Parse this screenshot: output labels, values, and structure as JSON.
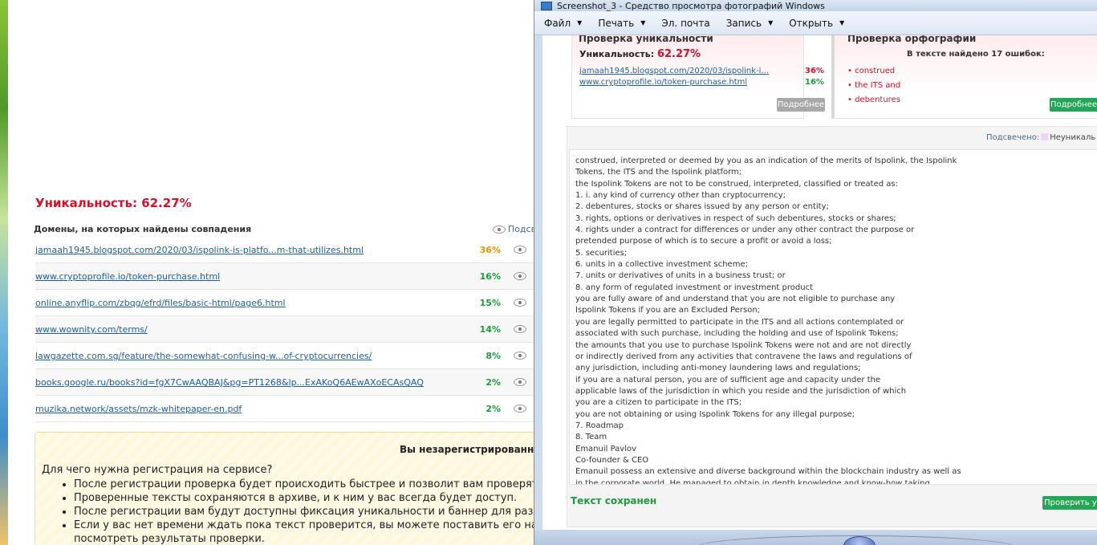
{
  "left_page": {
    "uniqueness_label": "Уникальность: ",
    "uniqueness_value": "62.27%",
    "domains_header": "Домены, на которых найдены совпадения",
    "highlight_link": "Подсв",
    "domains": [
      {
        "url": "jamaah1945.blogspot.com/2020/03/ispolink-is-platfo...m-that-utilizes.html",
        "percent": "36%",
        "color": "orange"
      },
      {
        "url": "www.cryptoprofile.io/token-purchase.html",
        "percent": "16%",
        "color": "green"
      },
      {
        "url": "online.anyflip.com/zbqg/efrd/files/basic-html/page6.html",
        "percent": "15%",
        "color": "green"
      },
      {
        "url": "www.wownity.com/terms/",
        "percent": "14%",
        "color": "green"
      },
      {
        "url": "lawgazette.com.sg/feature/the-somewhat-confusing-w...of-cryptocurrencies/",
        "percent": "8%",
        "color": "green"
      },
      {
        "url": "books.google.ru/books?id=fgX7CwAAQBAJ&pg=PT1268&lp...ExAKoQ6AEwAXoECAsQAQ",
        "percent": "2%",
        "color": "green"
      },
      {
        "url": "muzika.network/assets/mzk-whitepaper-en.pdf",
        "percent": "2%",
        "color": "green"
      }
    ],
    "notice": {
      "title": "Вы незарегистрированн",
      "question": "Для чего нужна регистрация на сервисе?",
      "items": [
        "После регистрации проверка будет происходить быстрее и позволит вам проверять больше те",
        "Проверенные тексты сохраняются в архиве, и к ним у вас всегда будет доступ.",
        "После регистрации вам будут доступны фиксация уникальности и баннер для размещения на с",
        "Если у вас нет времени ждать пока текст проверится, вы можете поставить его на проверку и",
        "посмотреть результаты проверки."
      ]
    }
  },
  "window": {
    "title": "Screenshot_3 - Средство просмотра фотографий Windows",
    "menu": [
      {
        "label": "Файл",
        "dropdown": true
      },
      {
        "label": "Печать",
        "dropdown": true
      },
      {
        "label": "Эл. почта",
        "dropdown": false
      },
      {
        "label": "Запись",
        "dropdown": true
      },
      {
        "label": "Открыть",
        "dropdown": true
      }
    ]
  },
  "viewer": {
    "uniq_card": {
      "title": "Проверка уникальности",
      "label": "Уникальность: ",
      "value": "62.27%",
      "links": [
        {
          "url": "jamaah1945.blogspot.com/2020/03/ispolink-i...",
          "percent": "36%",
          "color": "red"
        },
        {
          "url": "www.cryptoprofile.io/token-purchase.html",
          "percent": "16%",
          "color": "green"
        }
      ],
      "button": "Подробнее"
    },
    "orth_card": {
      "title": "Проверка орфографии",
      "subtitle": "В тексте найдено 17 ошибок:",
      "errors": [
        "• construed",
        "• the ITS and",
        "• debentures"
      ],
      "button": "Подробнее"
    },
    "highlight_label": "Подсвечено:",
    "highlight_rest": "Неуникаль",
    "text_lines": [
      "construed, interpreted or deemed by you as an indication of the merits of Ispolink, the Ispolink",
      "Tokens, the ITS and the Ispolink platform;",
      "the Ispolink Tokens are not to be construed, interpreted, classified or treated as:",
      "1. i. any kind of currency other than cryptocurrency;",
      "2. debentures, stocks or shares issued by any person or entity;",
      "3. rights, options or derivatives in respect of such debentures, stocks or shares;",
      "4. rights under a contract for differences or under any other contract the purpose or",
      "pretended purpose of which is to secure a profit or avoid a loss;",
      "5. securities;",
      "6. units in a collective investment scheme;",
      "7. units or derivatives of units in a business trust; or",
      "8. any form of regulated investment or investment product",
      "you are fully aware of and understand that you are not eligible to purchase any",
      "Ispolink Tokens if you are an Excluded Person;",
      "you are legally permitted to participate in the ITS and all actions contemplated or",
      "associated with such purchase, including the holding and use of Ispolink Tokens;",
      "the amounts that you use to purchase Ispolink Tokens were not and are not directly",
      "or indirectly derived from any activities that contravene the laws and regulations of",
      "any jurisdiction, including anti-money laundering laws and regulations;",
      "if you are a natural person, you are of sufficient age and capacity under the",
      "applicable laws of the jurisdiction in which you reside and the jurisdiction of which",
      "you are a citizen to participate in the ITS;",
      "you are not obtaining or using Ispolink Tokens for any illegal purpose;",
      "7. Roadmap",
      "8. Team",
      "Emanuil Pavlov",
      "Co-founder & CEO",
      "Emanuil possess an extensive and diverse background within the blockchain industry as well as",
      "in the corporate world. He managed to obtain in depth knowledge and know-how taking"
    ],
    "saved_text": "Текст сохранен",
    "check_button": "Проверить у"
  },
  "colors": {
    "red": "#d4112a",
    "green": "#1f9b3f",
    "orange": "#f09000",
    "link": "#1f5fa0",
    "highlight": "#edd6f7"
  }
}
